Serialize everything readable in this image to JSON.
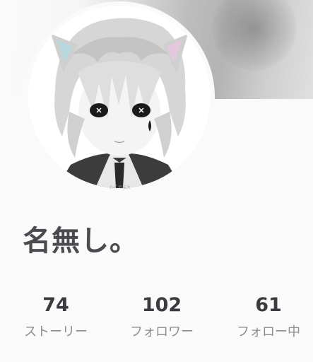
{
  "profile": {
    "display_name": "名無し。",
    "avatar_caption": "ﾀｯﾌﾟで拡大",
    "avatar_icon": "character-portrait"
  },
  "stats": [
    {
      "count": "74",
      "label": "ストーリー"
    },
    {
      "count": "102",
      "label": "フォロワー"
    },
    {
      "count": "61",
      "label": "フォロー中"
    }
  ],
  "colors": {
    "background": "#fafafa",
    "name_text": "#4a4a4f",
    "count_text": "#3a3a3f",
    "label_text": "#8c8c92"
  }
}
